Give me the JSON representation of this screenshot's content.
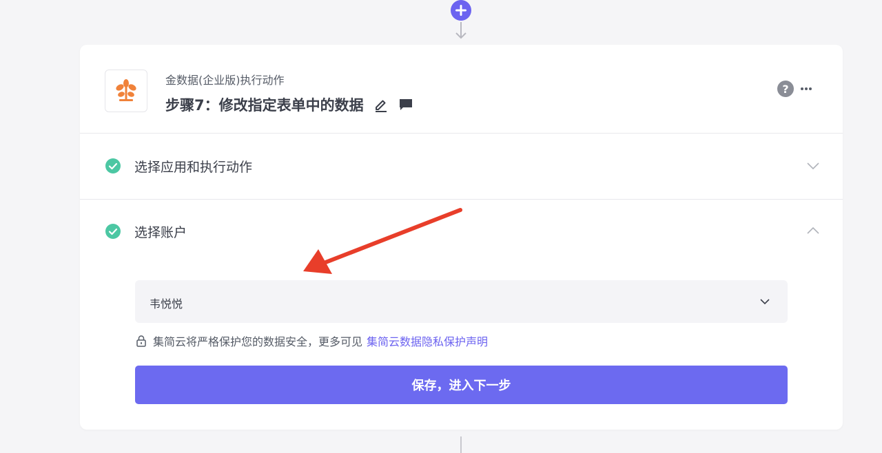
{
  "header": {
    "app_name": "金数据(企业版)执行动作",
    "step_title": "步骤7：修改指定表单中的数据",
    "help_label": "?"
  },
  "sections": [
    {
      "label": "选择应用和执行动作",
      "status": "complete",
      "expanded": false
    },
    {
      "label": "选择账户",
      "status": "complete",
      "expanded": true
    }
  ],
  "account": {
    "selected_value": "韦悦悦"
  },
  "privacy": {
    "text": "集简云将严格保护您的数据安全，更多可见",
    "link_text": "集简云数据隐私保护声明"
  },
  "actions": {
    "save_next_label": "保存，进入下一步"
  },
  "colors": {
    "accent": "#6c63f0",
    "check_green": "#4cc7a3",
    "logo_orange": "#f0823a",
    "annotation_red": "#e83e2a"
  },
  "icons": {
    "add": "plus-icon",
    "edit": "pencil-icon",
    "comment": "comment-icon",
    "help": "question-icon",
    "more": "ellipsis-icon",
    "check": "check-circle-icon",
    "lock": "lock-icon"
  }
}
